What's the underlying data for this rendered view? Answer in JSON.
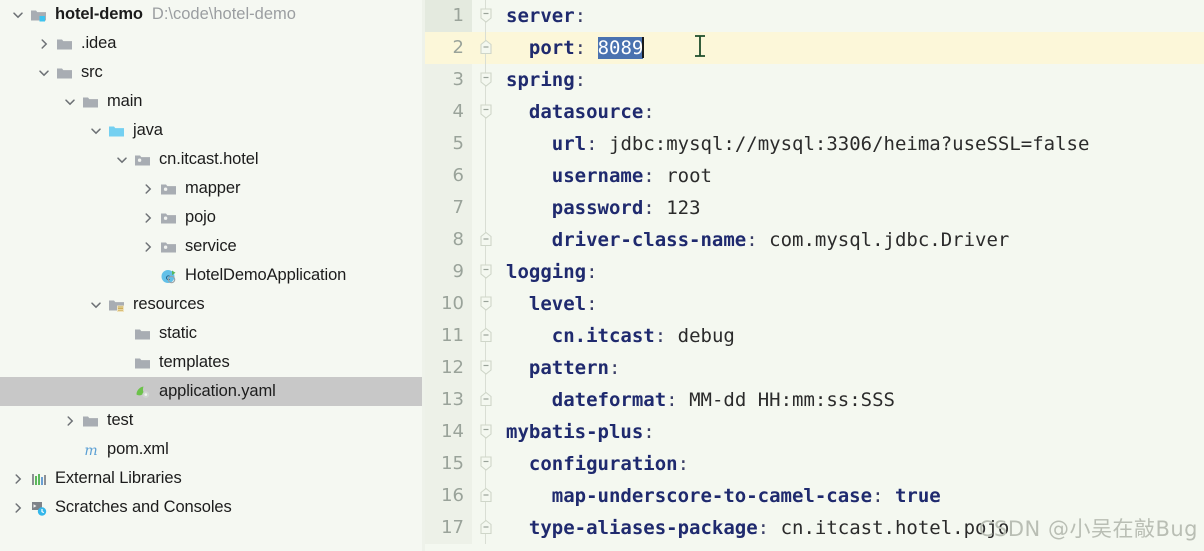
{
  "colors": {
    "tree_bg": "#f5f8f2",
    "editor_bg": "#f4f8f0",
    "gutter_bg": "#edf1e8",
    "caret_line": "#fcf7d9",
    "selection_bg": "#4a72b0",
    "selection_fg": "#ffffff",
    "tree_selected_bg": "#c8c8c8",
    "key_color": "#1f2a6e",
    "path_color": "#9b9ea1",
    "watermark_color": "#b9beb4"
  },
  "project_tree": {
    "items": [
      {
        "label": "hotel-demo",
        "detail": "D:\\code\\hotel-demo",
        "depth": 0,
        "twisty": "expanded",
        "icon": "module-folder-icon",
        "bold": true,
        "selected": false
      },
      {
        "label": ".idea",
        "detail": "",
        "depth": 1,
        "twisty": "collapsed",
        "icon": "folder-icon",
        "bold": false,
        "selected": false
      },
      {
        "label": "src",
        "detail": "",
        "depth": 1,
        "twisty": "expanded",
        "icon": "folder-icon",
        "bold": false,
        "selected": false
      },
      {
        "label": "main",
        "detail": "",
        "depth": 2,
        "twisty": "expanded",
        "icon": "folder-icon",
        "bold": false,
        "selected": false
      },
      {
        "label": "java",
        "detail": "",
        "depth": 3,
        "twisty": "expanded",
        "icon": "source-root-icon",
        "bold": false,
        "selected": false
      },
      {
        "label": "cn.itcast.hotel",
        "detail": "",
        "depth": 4,
        "twisty": "expanded",
        "icon": "package-icon",
        "bold": false,
        "selected": false
      },
      {
        "label": "mapper",
        "detail": "",
        "depth": 5,
        "twisty": "collapsed",
        "icon": "package-icon",
        "bold": false,
        "selected": false
      },
      {
        "label": "pojo",
        "detail": "",
        "depth": 5,
        "twisty": "collapsed",
        "icon": "package-icon",
        "bold": false,
        "selected": false
      },
      {
        "label": "service",
        "detail": "",
        "depth": 5,
        "twisty": "collapsed",
        "icon": "package-icon",
        "bold": false,
        "selected": false
      },
      {
        "label": "HotelDemoApplication",
        "detail": "",
        "depth": 5,
        "twisty": "none",
        "icon": "spring-class-icon",
        "bold": false,
        "selected": false
      },
      {
        "label": "resources",
        "detail": "",
        "depth": 3,
        "twisty": "expanded",
        "icon": "resources-root-icon",
        "bold": false,
        "selected": false
      },
      {
        "label": "static",
        "detail": "",
        "depth": 4,
        "twisty": "none",
        "icon": "folder-icon",
        "bold": false,
        "selected": false
      },
      {
        "label": "templates",
        "detail": "",
        "depth": 4,
        "twisty": "none",
        "icon": "folder-icon",
        "bold": false,
        "selected": false
      },
      {
        "label": "application.yaml",
        "detail": "",
        "depth": 4,
        "twisty": "none",
        "icon": "yaml-file-icon",
        "bold": false,
        "selected": true
      },
      {
        "label": "test",
        "detail": "",
        "depth": 2,
        "twisty": "collapsed",
        "icon": "folder-icon",
        "bold": false,
        "selected": false
      },
      {
        "label": "pom.xml",
        "detail": "",
        "depth": 2,
        "twisty": "none",
        "icon": "maven-icon",
        "bold": false,
        "selected": false
      },
      {
        "label": "External Libraries",
        "detail": "",
        "depth": 0,
        "twisty": "collapsed",
        "icon": "libraries-icon",
        "bold": false,
        "selected": false
      },
      {
        "label": "Scratches and Consoles",
        "detail": "",
        "depth": 0,
        "twisty": "collapsed",
        "icon": "scratches-icon",
        "bold": false,
        "selected": false
      }
    ]
  },
  "editor": {
    "filename": "application.yaml",
    "selection_text": "8089",
    "caret_line_number": 2,
    "lines": [
      {
        "num": "1",
        "indent": 0,
        "fold": "open",
        "key": "server",
        "punct": ":",
        "value": ""
      },
      {
        "num": "2",
        "indent": 1,
        "fold": "end",
        "key": "port",
        "punct": ":",
        "value": "8089",
        "value_selected": true
      },
      {
        "num": "3",
        "indent": 0,
        "fold": "open",
        "key": "spring",
        "punct": ":",
        "value": ""
      },
      {
        "num": "4",
        "indent": 1,
        "fold": "open",
        "key": "datasource",
        "punct": ":",
        "value": ""
      },
      {
        "num": "5",
        "indent": 2,
        "fold": "none",
        "key": "url",
        "punct": ":",
        "value": "jdbc:mysql://mysql:3306/heima?useSSL=false"
      },
      {
        "num": "6",
        "indent": 2,
        "fold": "none",
        "key": "username",
        "punct": ":",
        "value": "root"
      },
      {
        "num": "7",
        "indent": 2,
        "fold": "none",
        "key": "password",
        "punct": ":",
        "value": "123"
      },
      {
        "num": "8",
        "indent": 2,
        "fold": "end",
        "key": "driver-class-name",
        "punct": ":",
        "value": "com.mysql.jdbc.Driver"
      },
      {
        "num": "9",
        "indent": 0,
        "fold": "open",
        "key": "logging",
        "punct": ":",
        "value": ""
      },
      {
        "num": "10",
        "indent": 1,
        "fold": "open",
        "key": "level",
        "punct": ":",
        "value": ""
      },
      {
        "num": "11",
        "indent": 2,
        "fold": "end",
        "key": "cn.itcast",
        "punct": ":",
        "value": "debug"
      },
      {
        "num": "12",
        "indent": 1,
        "fold": "open",
        "key": "pattern",
        "punct": ":",
        "value": ""
      },
      {
        "num": "13",
        "indent": 2,
        "fold": "end",
        "key": "dateformat",
        "punct": ":",
        "value": "MM-dd HH:mm:ss:SSS"
      },
      {
        "num": "14",
        "indent": 0,
        "fold": "open",
        "key": "mybatis-plus",
        "punct": ":",
        "value": ""
      },
      {
        "num": "15",
        "indent": 1,
        "fold": "open",
        "key": "configuration",
        "punct": ":",
        "value": ""
      },
      {
        "num": "16",
        "indent": 2,
        "fold": "end",
        "key": "map-underscore-to-camel-case",
        "punct": ":",
        "value": "true",
        "value_is_keyword": true
      },
      {
        "num": "17",
        "indent": 1,
        "fold": "end",
        "key": "type-aliases-package",
        "punct": ":",
        "value": "cn.itcast.hotel.pojo"
      }
    ]
  },
  "watermark": {
    "text": "CSDN @小吴在敲Bug"
  }
}
